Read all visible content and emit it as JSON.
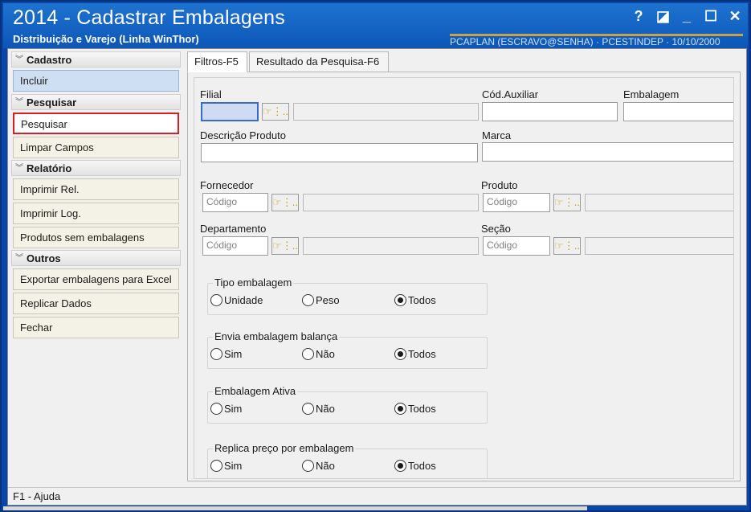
{
  "window": {
    "title": "2014 - Cadastrar Embalagens",
    "subtitle": "Distribuição e Varejo (Linha WinThor)",
    "right_info": "PCAPLAN (ESCRAVO@SENHA) · PCESTINDEP · 10/10/2000",
    "controls": {
      "help": "?",
      "restore": "◪",
      "minimize": "_",
      "maximize": "☐",
      "close": "✕"
    }
  },
  "sidebar": {
    "groups": [
      {
        "title": "Cadastro",
        "items": [
          {
            "label": "Incluir",
            "state": "active"
          }
        ]
      },
      {
        "title": "Pesquisar",
        "items": [
          {
            "label": "Pesquisar",
            "state": "highlight"
          },
          {
            "label": "Limpar Campos"
          }
        ]
      },
      {
        "title": "Relatório",
        "items": [
          {
            "label": "Imprimir Rel."
          },
          {
            "label": "Imprimir Log."
          },
          {
            "label": "Produtos sem embalagens"
          }
        ]
      },
      {
        "title": "Outros",
        "items": [
          {
            "label": "Exportar embalagens para Excel"
          },
          {
            "label": "Replicar Dados"
          },
          {
            "label": "Fechar"
          }
        ]
      }
    ]
  },
  "tabs": {
    "filtros": "Filtros-F5",
    "resultado": "Resultado da Pesquisa-F6"
  },
  "filters": {
    "filial_label": "Filial",
    "cod_aux_label": "Cód.Auxiliar",
    "embalagem_label": "Embalagem",
    "descricao_label": "Descrição Produto",
    "marca_label": "Marca",
    "fornecedor_label": "Fornecedor",
    "produto_label": "Produto",
    "departamento_label": "Departamento",
    "secao_label": "Seção",
    "codigo_placeholder": "Código",
    "lookup_glyph": "☞⋮.."
  },
  "radio_groups": [
    {
      "title": "Tipo embalagem",
      "options": [
        "Unidade",
        "Peso",
        "Todos"
      ],
      "selected": 2
    },
    {
      "title": "Envia embalagem balança",
      "options": [
        "Sim",
        "Não",
        "Todos"
      ],
      "selected": 2
    },
    {
      "title": "Embalagem Ativa",
      "options": [
        "Sim",
        "Não",
        "Todos"
      ],
      "selected": 2
    },
    {
      "title": "Replica preço por embalagem",
      "options": [
        "Sim",
        "Não",
        "Todos"
      ],
      "selected": 2
    }
  ],
  "status": {
    "help": "F1 - Ajuda"
  }
}
